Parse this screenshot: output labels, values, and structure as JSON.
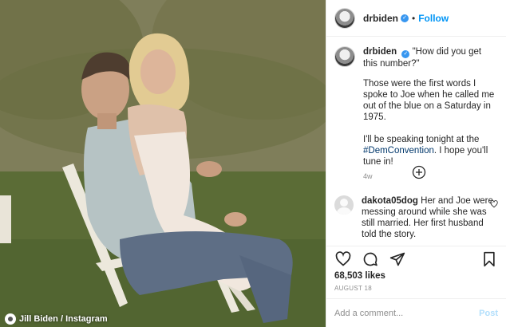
{
  "photo": {
    "alt": "",
    "credit": "Jill Biden / Instagram"
  },
  "header": {
    "username": "drbiden",
    "separator": "•",
    "follow_label": "Follow"
  },
  "caption": {
    "username": "drbiden",
    "quote": "\"How did you get this number?\"",
    "paragraph1": "Those were the first words I spoke to Joe when he called me out of the blue on a Saturday in 1975.",
    "paragraph2_before": "I'll be speaking tonight at the ",
    "hashtag": "#DemConvention",
    "paragraph2_after": ". I hope you'll tune in!",
    "time_ago": "4w"
  },
  "comment": {
    "username": "dakota05dog",
    "text": "Her and Joe were messing around while she was still married. Her first husband told the story."
  },
  "stats": {
    "likes": "68,503 likes",
    "date": "AUGUST 18"
  },
  "add_comment": {
    "placeholder": "Add a comment...",
    "post_label": "Post"
  },
  "icons": {
    "like": "heart-icon",
    "comment": "comment-icon",
    "share": "share-icon",
    "save": "bookmark-icon",
    "load_more": "plus-circle-icon",
    "verified": "verified-badge-icon"
  },
  "colors": {
    "link_blue": "#0095f6",
    "verified_blue": "#3897f0",
    "hashtag": "#00376b",
    "muted": "#8e8e8e",
    "post_disabled": "#b2dffc"
  }
}
